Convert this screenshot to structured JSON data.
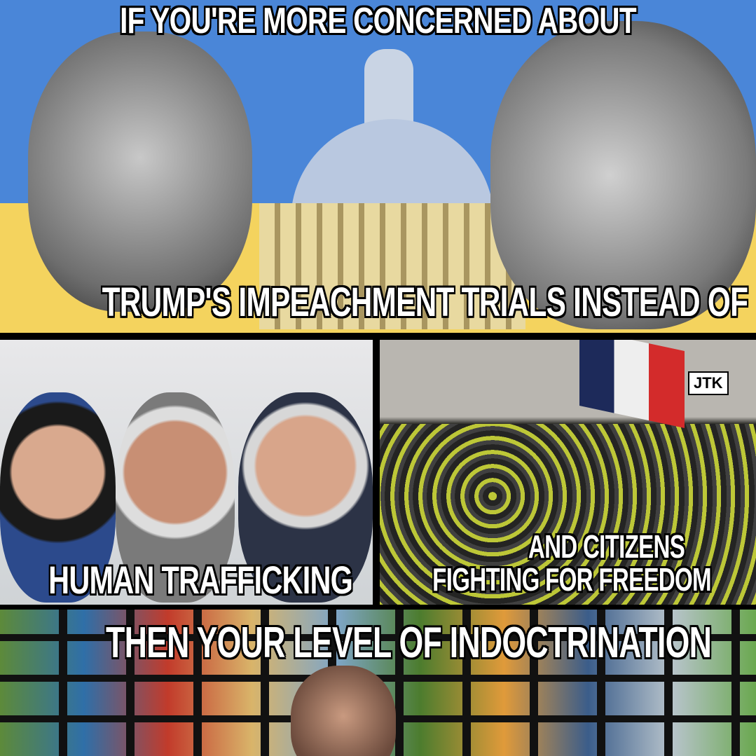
{
  "top": {
    "line1": "IF YOU'RE MORE CONCERNED ABOUT",
    "line2": "TRUMP'S IMPEACHMENT TRIALS INSTEAD OF",
    "colors": {
      "sky": "#4a86d8",
      "yellow": "#f4d35e"
    }
  },
  "middle_left": {
    "caption": "HUMAN TRAFFICKING"
  },
  "middle_right": {
    "caption_line1": "AND CITIZENS",
    "caption_line2": "FIGHTING FOR FREEDOM",
    "watermark": "JTK"
  },
  "bottom": {
    "caption": "THEN YOUR LEVEL OF INDOCTRINATION"
  }
}
